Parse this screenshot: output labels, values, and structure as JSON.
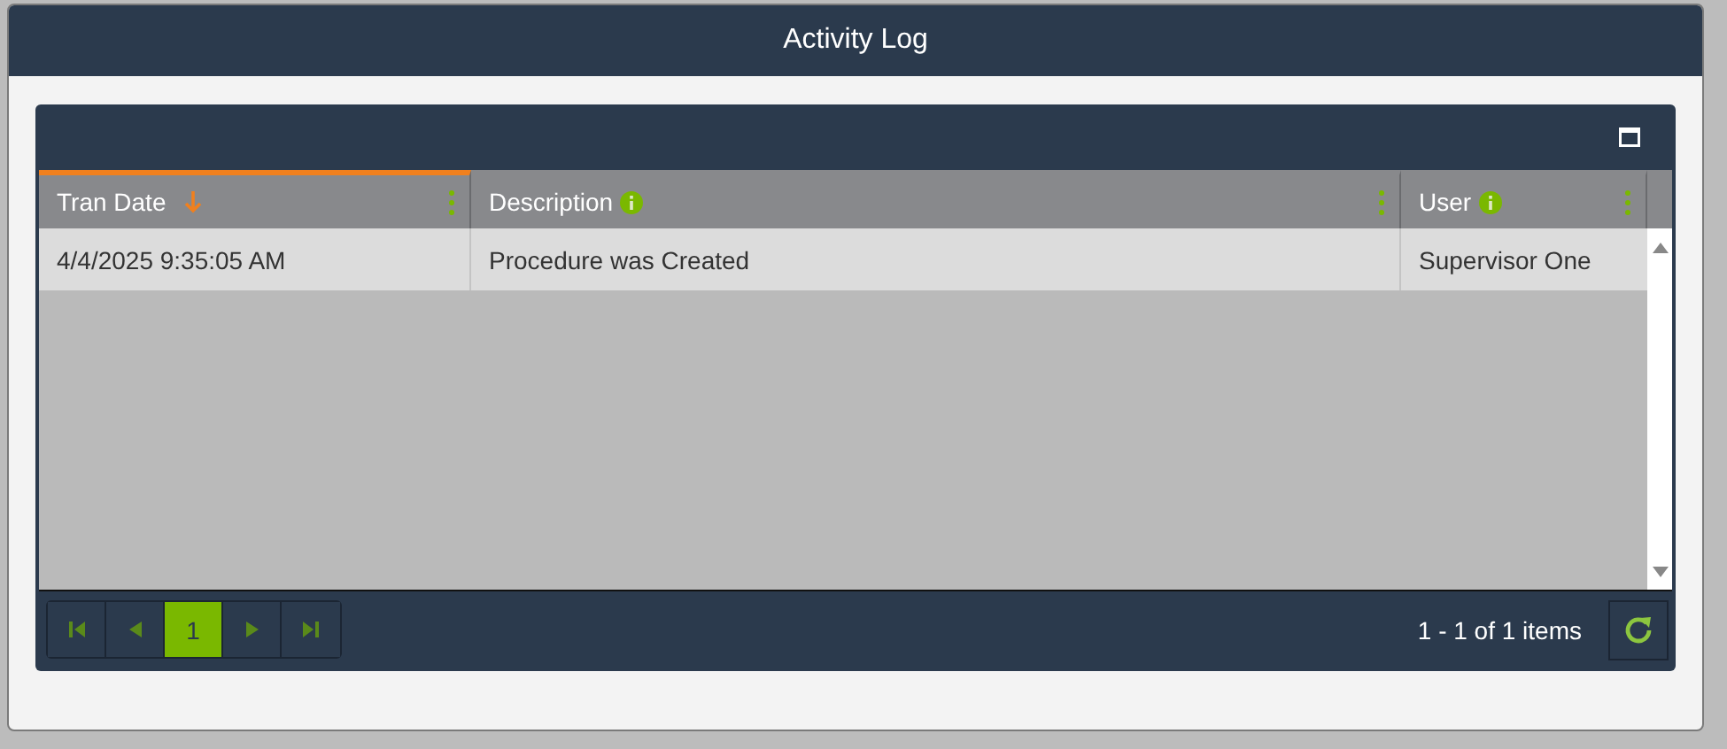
{
  "window": {
    "title": "Activity Log"
  },
  "table": {
    "columns": [
      {
        "label": "Tran Date",
        "sorted": true,
        "info": false
      },
      {
        "label": "Description",
        "sorted": false,
        "info": true
      },
      {
        "label": "User",
        "sorted": false,
        "info": true
      }
    ],
    "rows": [
      {
        "cells": [
          "4/4/2025 9:35:05 AM",
          "Procedure was Created",
          "Supervisor One"
        ]
      }
    ]
  },
  "pager": {
    "pages": [
      {
        "label": "1",
        "selected": true
      }
    ],
    "summary": "1 - 1 of 1 items"
  }
}
